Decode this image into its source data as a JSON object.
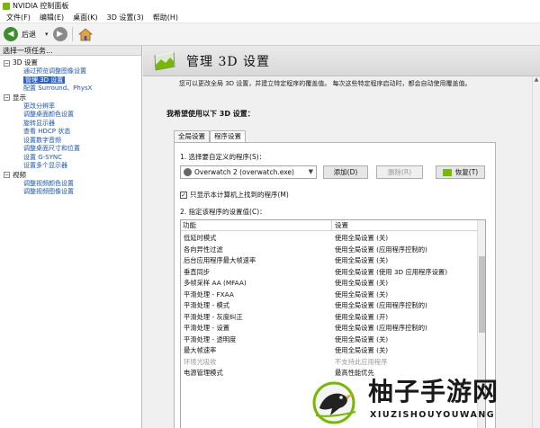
{
  "window": {
    "title": "NVIDIA 控制面板"
  },
  "menu": [
    "文件(F)",
    "编辑(E)",
    "桌面(K)",
    "3D 设置(3)",
    "帮助(H)"
  ],
  "toolbar": {
    "back_label": "后退"
  },
  "left": {
    "task_title": "选择一项任务...",
    "tree": {
      "cat3d": "3D 设置",
      "cat3d_items": [
        "通过预览调整图像设置",
        "管理 3D 设置",
        "配置 Surround、PhysX"
      ],
      "catDisplay": "显示",
      "catDisplay_items": [
        "更改分辨率",
        "调整桌面颜色设置",
        "旋转显示器",
        "查看 HDCP 状态",
        "设置数字音频",
        "调整桌面尺寸和位置",
        "设置 G-SYNC",
        "设置多个显示器"
      ],
      "catVideo": "视频",
      "catVideo_items": [
        "调整视频颜色设置",
        "调整视频图像设置"
      ]
    }
  },
  "right": {
    "title": "管理 3D 设置",
    "description": "您可以更改全局 3D 设置，并建立特定程序的覆盖值。 每次这些特定程序启动时，都会自动使用覆盖值。",
    "section": "我希望使用以下 3D 设置：",
    "tabs": [
      "全局设置",
      "程序设置"
    ],
    "step1": "1. 选择要自定义的程序(S)：",
    "program": "Overwatch 2 (overwatch.exe)",
    "btn_add": "添加(D)",
    "btn_delete": "删除(R)",
    "btn_restore": "恢复(T)",
    "checkbox_label": "只显示本计算机上找到的程序(M)",
    "checkbox_checked": "✓",
    "step2": "2. 指定该程序的设置值(C)：",
    "col_feature": "功能",
    "col_setting": "设置",
    "rows": [
      {
        "feature": "低延时模式",
        "setting": "使用全局设置 (关)"
      },
      {
        "feature": "各向异性过滤",
        "setting": "使用全局设置 (应用程序控制的)"
      },
      {
        "feature": "后台应用程序最大帧速率",
        "setting": "使用全局设置 (关)"
      },
      {
        "feature": "垂直同步",
        "setting": "使用全局设置 (使用 3D 应用程序设置)"
      },
      {
        "feature": "多帧采样 AA (MFAA)",
        "setting": "使用全局设置 (关)"
      },
      {
        "feature": "平滑处理 - FXAA",
        "setting": "使用全局设置 (关)"
      },
      {
        "feature": "平滑处理 - 模式",
        "setting": "使用全局设置 (应用程序控制的)"
      },
      {
        "feature": "平滑处理 - 灰度纠正",
        "setting": "使用全局设置 (开)"
      },
      {
        "feature": "平滑处理 - 设置",
        "setting": "使用全局设置 (应用程序控制的)"
      },
      {
        "feature": "平滑处理 - 透明度",
        "setting": "使用全局设置 (关)"
      },
      {
        "feature": "最大帧速率",
        "setting": "使用全局设置 (关)"
      },
      {
        "feature": "环境光吸收",
        "setting": "不支持此应用程序"
      },
      {
        "feature": "电源管理模式",
        "setting": "最高性能优先"
      }
    ]
  },
  "watermark": {
    "cn": "柚子手游网",
    "en": "XIUZISHOUYOUWANG"
  },
  "colors": {
    "nvidia_green": "#76b900",
    "selection": "#2a62c9",
    "link": "#1a56b3"
  }
}
